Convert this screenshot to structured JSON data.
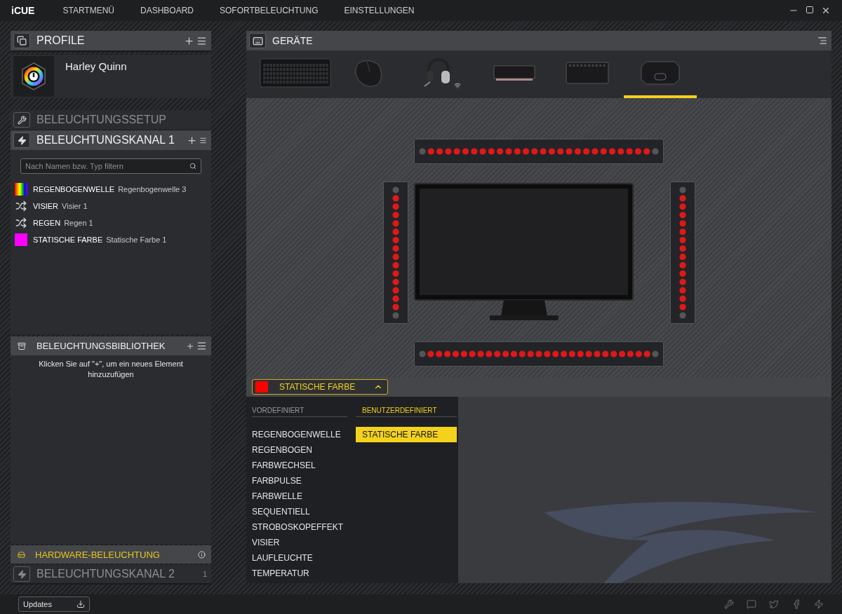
{
  "app": {
    "name": "iCUE"
  },
  "nav": [
    {
      "label": "STARTMENÜ"
    },
    {
      "label": "DASHBOARD"
    },
    {
      "label": "SOFORTBELEUCHTUNG"
    },
    {
      "label": "EINSTELLUNGEN"
    }
  ],
  "profiles": {
    "title": "PROFILE",
    "items": [
      {
        "name": "Harley Quinn"
      }
    ]
  },
  "lighting_setup": {
    "title": "BELEUCHTUNGSSETUP"
  },
  "channel_1": {
    "title": "BELEUCHTUNGSKANAL 1",
    "search": {
      "placeholder": "Nach Namen bzw. Typ filtern"
    },
    "effects": [
      {
        "kind": "gradient",
        "type": "REGENBOGENWELLE",
        "name": "Regenbogenwelle 3"
      },
      {
        "kind": "shuffle",
        "type": "VISIER",
        "name": "Visier 1"
      },
      {
        "kind": "shuffle",
        "type": "REGEN",
        "name": "Regen 1"
      },
      {
        "kind": "color",
        "color": "#ff00ff",
        "type": "STATISCHE FARBE",
        "name": "Statische Farbe 1"
      }
    ]
  },
  "library": {
    "title": "BELEUCHTUNGSBIBLIOTHEK",
    "hint": "Klicken Sie auf \"+\", um ein neues Element hinzuzufügen"
  },
  "hardware_lighting": {
    "label": "HARDWARE-BELEUCHTUNG"
  },
  "channel_2": {
    "title": "BELEUCHTUNGSKANAL 2",
    "count": "1"
  },
  "updates_button": {
    "label": "Updates"
  },
  "devices": {
    "title": "GERÄTE",
    "items": [
      {
        "kind": "keyboard",
        "selected": false
      },
      {
        "kind": "mouse",
        "selected": false
      },
      {
        "kind": "headset",
        "selected": false,
        "wireless": true
      },
      {
        "kind": "memory",
        "selected": false
      },
      {
        "kind": "controller",
        "selected": false
      },
      {
        "kind": "hub",
        "selected": true
      }
    ]
  },
  "effect_selector": {
    "color": "#ff0000",
    "label": "STATISCHE FARBE",
    "expanded": true
  },
  "effect_menu": {
    "predefined": {
      "title": "VORDEFINIERT",
      "items": [
        {
          "label": "REGENBOGENWELLE",
          "selected": false
        },
        {
          "label": "REGENBOGEN",
          "selected": false
        },
        {
          "label": "FARBWECHSEL",
          "selected": false
        },
        {
          "label": "FARBPULSE",
          "selected": false
        },
        {
          "label": "FARBWELLE",
          "selected": false
        },
        {
          "label": "SEQUENTIELL",
          "selected": false
        },
        {
          "label": "STROBOSKOPEFFEKT",
          "selected": false
        },
        {
          "label": "VISIER",
          "selected": false
        },
        {
          "label": "LAUFLEUCHTE",
          "selected": false
        },
        {
          "label": "TEMPERATUR",
          "selected": false
        }
      ]
    },
    "custom": {
      "title": "BENUTZERDEFINIERT",
      "items": [
        {
          "label": "STATISCHE FARBE",
          "selected": true
        }
      ]
    }
  }
}
